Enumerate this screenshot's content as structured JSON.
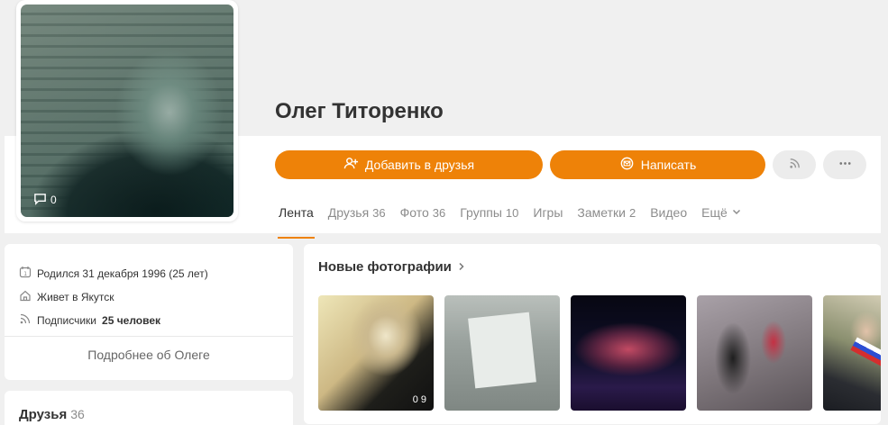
{
  "profile": {
    "name": "Олег Титоренко",
    "avatar_stats": {
      "comments": "0"
    },
    "actions": {
      "add_friend_label": "Добавить в друзья",
      "message_label": "Написать"
    },
    "tabs": [
      {
        "label": "Лента",
        "count": ""
      },
      {
        "label": "Друзья",
        "count": "36"
      },
      {
        "label": "Фото",
        "count": "36"
      },
      {
        "label": "Группы",
        "count": "10"
      },
      {
        "label": "Игры",
        "count": ""
      },
      {
        "label": "Заметки",
        "count": "2"
      },
      {
        "label": "Видео",
        "count": ""
      },
      {
        "label": "Ещё",
        "count": ""
      }
    ]
  },
  "info": {
    "born": "Родился 31 декабря 1996 (25 лет)",
    "lives": "Живет в Якутск",
    "subscribers_label": "Подписчики",
    "subscribers_value": "25 человек",
    "more_link": "Подробнее об Олеге"
  },
  "friends": {
    "title": "Друзья",
    "count": "36"
  },
  "photos": {
    "title": "Новые фотографии",
    "first_photo_stat": "0 9"
  },
  "colors": {
    "accent": "#ee8208",
    "background": "#f0f0f0"
  },
  "icons": [
    "comment-icon",
    "add-user-icon",
    "mail-icon",
    "rss-icon",
    "more-icon",
    "calendar-icon",
    "home-icon",
    "subscribers-icon",
    "chevron-right-icon",
    "chevron-down-icon"
  ]
}
